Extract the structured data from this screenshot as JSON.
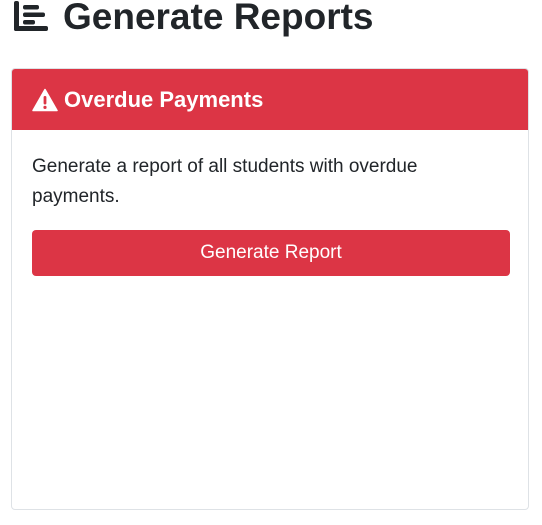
{
  "page": {
    "title": "Generate Reports",
    "title_icon": "report-list-icon"
  },
  "card": {
    "title": "Overdue Payments",
    "title_icon": "warning-triangle-icon",
    "description": "Generate a report of all students with overdue payments.",
    "button_label": "Generate Report"
  },
  "colors": {
    "danger": "#dc3545",
    "text": "#212529",
    "border": "#dee2e6"
  }
}
